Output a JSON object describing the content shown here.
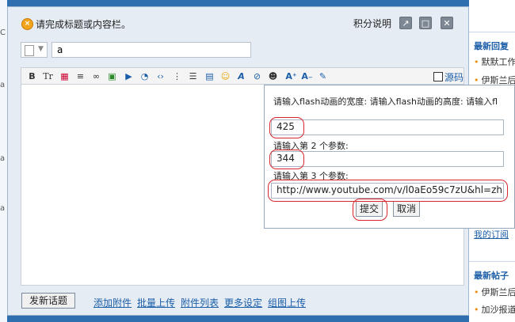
{
  "alert": {
    "icon": "close-circle-icon",
    "message": "请完成标题或内容栏。"
  },
  "header": {
    "points_link": "积分说明",
    "window_buttons": [
      "popout-icon",
      "maximize-icon",
      "close-icon"
    ]
  },
  "title_input": {
    "value": "a"
  },
  "toolbar": {
    "buttons": [
      "bold-icon",
      "font-size-icon",
      "color-icon",
      "align-icon",
      "link-icon",
      "image-icon",
      "media-icon",
      "quote-icon",
      "code-icon",
      "ordered-list-icon",
      "indent-icon",
      "table-icon",
      "smiley-icon",
      "font-icon",
      "flash-icon",
      "qq-icon",
      "superscript-icon",
      "subscript-icon",
      "tools-icon"
    ],
    "source_label": "源码"
  },
  "flash_popup": {
    "size_prompt": "请输入flash动画的宽度: 请输入flash动画的高度: 请输入fl",
    "width_value": "425",
    "param2_prompt": "请输入第 2 个参数:",
    "height_value": "344",
    "param3_prompt": "请输入第 3 个参数:",
    "url_value": "http://www.youtube.com/v/l0aEo59c7zU&hl=zh",
    "submit_label": "提交",
    "cancel_label": "取消"
  },
  "footer": {
    "post_button": "发新话题",
    "links": [
      "添加附件",
      "批量上传",
      "附件列表",
      "更多设定",
      "组图上传"
    ]
  },
  "background": {
    "left_marks": [
      "C",
      "a",
      "a",
      "a"
    ],
    "right_header1": "最新回复",
    "right_items1": [
      "默默工作",
      "伊斯兰后"
    ],
    "right_link": "我的订阅",
    "right_header2": "最新帖子",
    "right_items2": [
      "伊斯兰后",
      "加沙报道"
    ]
  }
}
